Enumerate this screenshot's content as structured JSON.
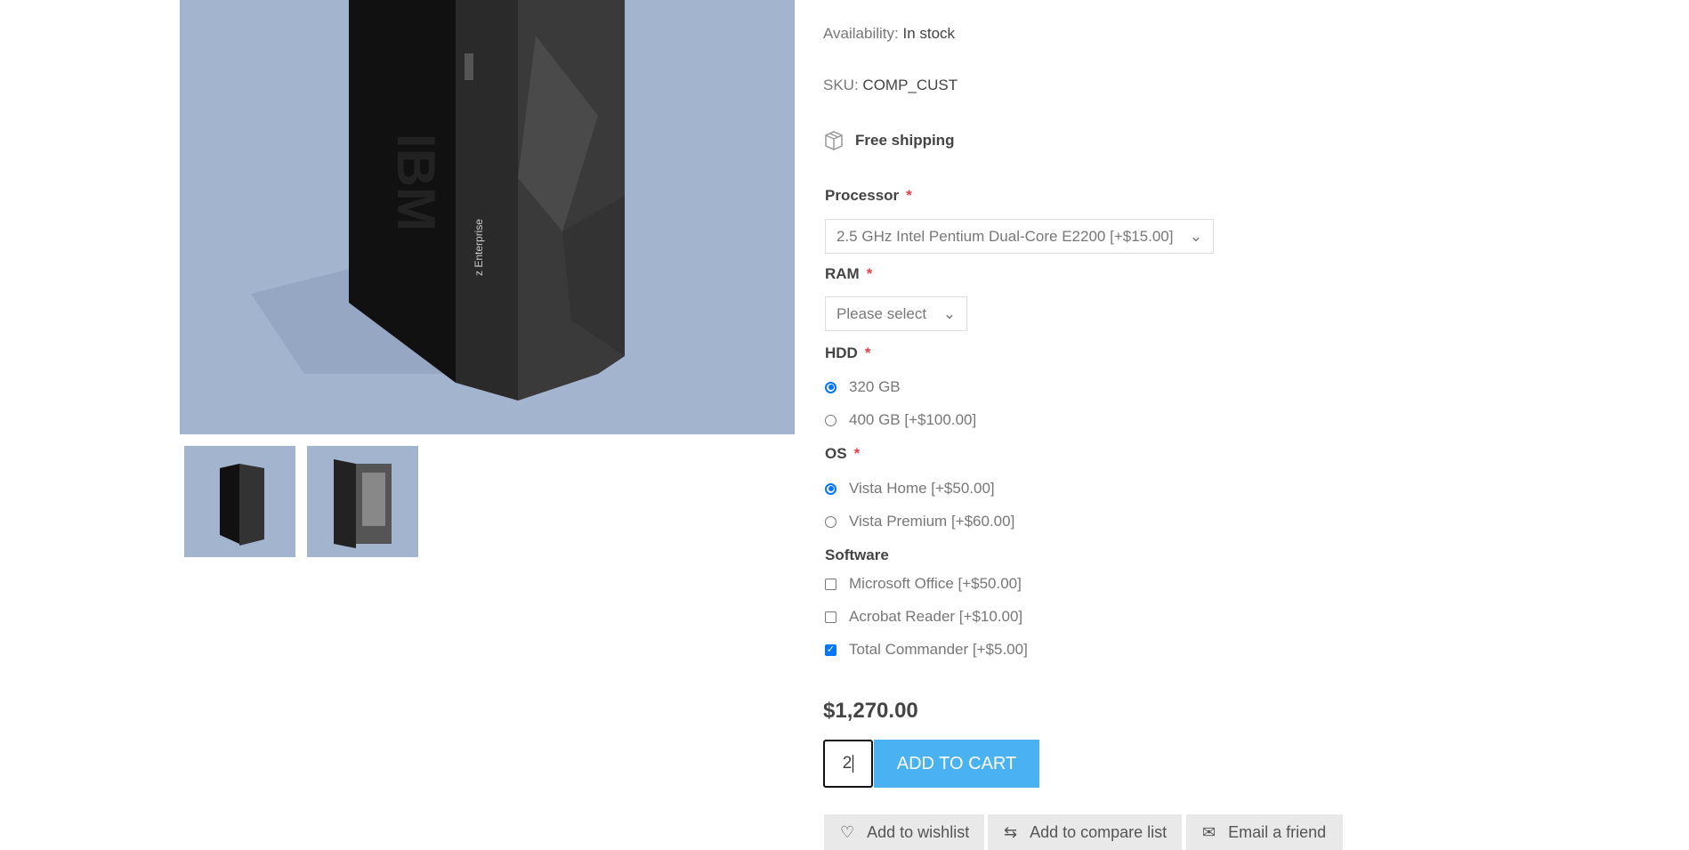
{
  "product": {
    "availability_label": "Availability:",
    "availability_value": "In stock",
    "sku_label": "SKU:",
    "sku_value": "COMP_CUST",
    "free_shipping": "Free shipping",
    "price": "$1,270.00",
    "image_brand_text": "IBM",
    "image_model_text": "z Enterprise"
  },
  "attributes": {
    "processor": {
      "label": "Processor",
      "required": "*",
      "selected": "2.5 GHz Intel Pentium Dual-Core E2200 [+$15.00]"
    },
    "ram": {
      "label": "RAM",
      "required": "*",
      "selected": "Please select"
    },
    "hdd": {
      "label": "HDD",
      "required": "*",
      "options": [
        {
          "label": "320 GB",
          "selected": true
        },
        {
          "label": "400 GB [+$100.00]",
          "selected": false
        }
      ]
    },
    "os": {
      "label": "OS",
      "required": "*",
      "options": [
        {
          "label": "Vista Home [+$50.00]",
          "selected": true
        },
        {
          "label": "Vista Premium [+$60.00]",
          "selected": false
        }
      ]
    },
    "software": {
      "label": "Software",
      "options": [
        {
          "label": "Microsoft Office [+$50.00]",
          "checked": false
        },
        {
          "label": "Acrobat Reader [+$10.00]",
          "checked": false
        },
        {
          "label": "Total Commander [+$5.00]",
          "checked": true
        }
      ]
    }
  },
  "cart": {
    "quantity": "2",
    "add_to_cart": "ADD TO CART"
  },
  "actions": {
    "wishlist": "Add to wishlist",
    "compare": "Add to compare list",
    "email": "Email a friend"
  },
  "colors": {
    "accent": "#4ab2f1",
    "required": "#e4434b",
    "image_bg": "#a3b4cf",
    "radio": "#0075ff"
  }
}
